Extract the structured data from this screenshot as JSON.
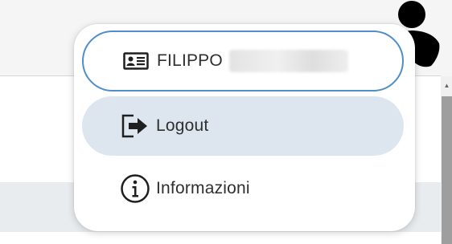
{
  "header": {
    "user_avatar": "person-silhouette-icon"
  },
  "user_menu": {
    "items": [
      {
        "label": "FILIPPO",
        "icon": "id-card-icon",
        "redacted_surname": true
      },
      {
        "label": "Logout",
        "icon": "logout-icon",
        "highlighted": true
      },
      {
        "label": "Informazioni",
        "icon": "info-icon"
      }
    ]
  },
  "colors": {
    "active_border": "#4e8fc7",
    "hover_background": "#dde6ef",
    "text": "#2f2f2f"
  }
}
